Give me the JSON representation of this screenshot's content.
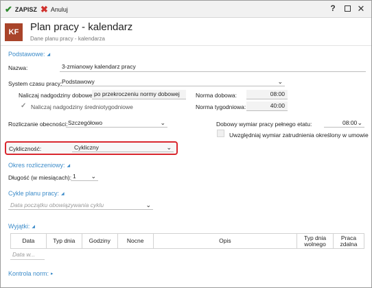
{
  "toolbar": {
    "save_label": "ZAPISZ",
    "cancel_label": "Anuluj",
    "help_label": "?"
  },
  "header": {
    "logo_text": "KF",
    "title": "Plan pracy - kalendarz",
    "subtitle": "Dane planu pracy - kalendarza"
  },
  "sections": {
    "basic": "Podstawowe:",
    "settlement_period": "Okres rozliczeniowy:",
    "work_cycles": "Cykle planu pracy:",
    "exceptions": "Wyjątki:",
    "norm_control": "Kontrola norm:"
  },
  "form": {
    "name_label": "Nazwa:",
    "name_value": "3-zmianowy kalendarz pracy",
    "time_system_label": "System czasu pracy:",
    "time_system_value": "Podstawowy",
    "overtime_daily_label": "Naliczaj nadgodziny dobowe:",
    "overtime_daily_value": "po przekroczeniu normy dobowej",
    "daily_norm_label": "Norma dobowa:",
    "daily_norm_value": "08:00",
    "overtime_avg_weekly_label": "Naliczaj nadgodziny średniotygodniowe",
    "weekly_norm_label": "Norma tygodniowa:",
    "weekly_norm_value": "40:00",
    "attendance_label": "Rozliczanie obecności:",
    "attendance_value": "Szczegółowo",
    "daily_fulltime_label": "Dobowy wymiar pracy pełnego etatu:",
    "daily_fulltime_value": "08:00",
    "consider_employment_label": "Uwzględniaj wymiar zatrudnienia określony w umowie",
    "cyclicity_label": "Cykliczność:",
    "cyclicity_value": "Cykliczny",
    "length_label": "Długość (w miesiącach):",
    "length_value": "1",
    "cycle_start_placeholder": "Data początku obowiązywania cyklu"
  },
  "exceptions_table": {
    "columns": [
      "Data",
      "Typ dnia",
      "Godziny",
      "Nocne",
      "Opis",
      "Typ dnia wolnego",
      "Praca zdalna"
    ],
    "date_placeholder": "Data w..."
  },
  "colors": {
    "accent": "#3b8bc9",
    "logo_bg": "#a9442a",
    "save_icon": "#2f8a2f",
    "cancel_icon": "#d0312d",
    "highlight_border": "#d9262d"
  }
}
